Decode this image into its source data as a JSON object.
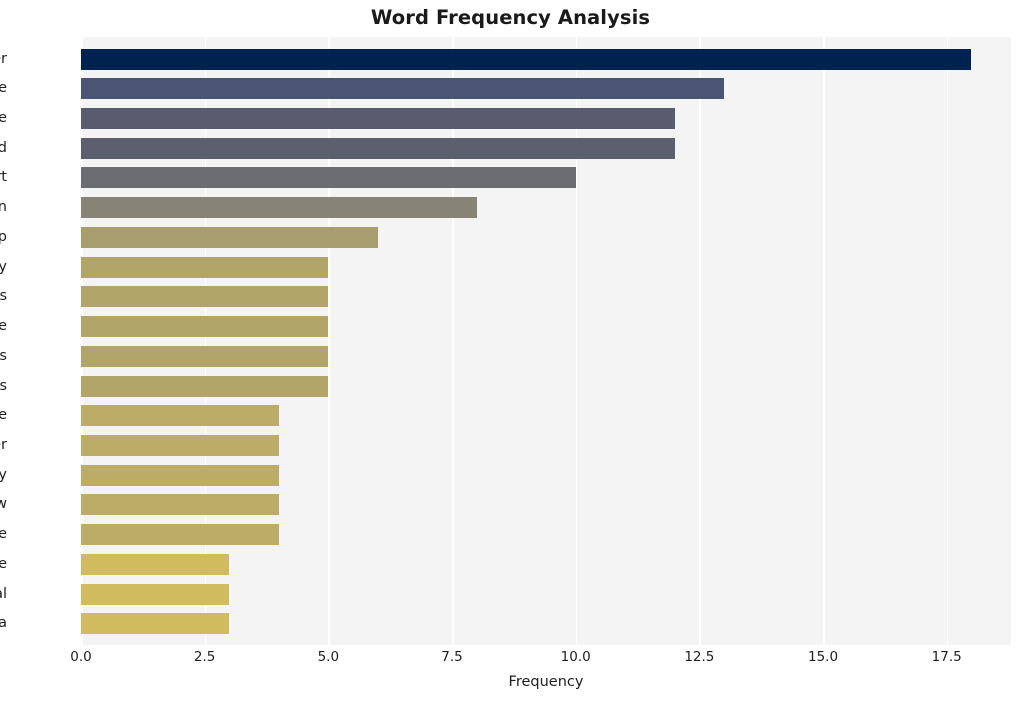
{
  "chart_data": {
    "type": "bar",
    "orientation": "horizontal",
    "title": "Word Frequency Analysis",
    "xlabel": "Frequency",
    "ylabel": "",
    "categories": [
      "officer",
      "time",
      "police",
      "spend",
      "report",
      "axon",
      "cop",
      "body",
      "cameras",
      "like",
      "agencies",
      "theres",
      "write",
      "taser",
      "try",
      "allow",
      "crime",
      "free",
      "lethal",
      "data"
    ],
    "values": [
      18,
      13,
      12,
      12,
      10,
      8,
      6,
      5,
      5,
      5,
      5,
      5,
      4,
      4,
      4,
      4,
      4,
      3,
      3,
      3
    ],
    "bar_colors": [
      "#00224e",
      "#4b5472",
      "#585c6e",
      "#5b5f6e",
      "#6c6d70",
      "#878375",
      "#a89d6e",
      "#b2a569",
      "#b2a569",
      "#b2a569",
      "#b2a569",
      "#b2a569",
      "#bcac67",
      "#bcac67",
      "#bcac67",
      "#bcac67",
      "#bcac67",
      "#d0bc5f",
      "#d0bc5f",
      "#d0bc5f"
    ],
    "xticks": [
      "0.0",
      "2.5",
      "5.0",
      "7.5",
      "10.0",
      "12.5",
      "15.0",
      "17.5"
    ],
    "xtick_values": [
      0,
      2.5,
      5,
      7.5,
      10,
      12.5,
      15,
      17.5
    ],
    "xlim": [
      0,
      18.8
    ],
    "grid": true,
    "grid_axis": "x",
    "legend": "none",
    "colormap": "cividis",
    "plot_background": "#f4f4f5",
    "gridline_color": "#ffffff"
  }
}
